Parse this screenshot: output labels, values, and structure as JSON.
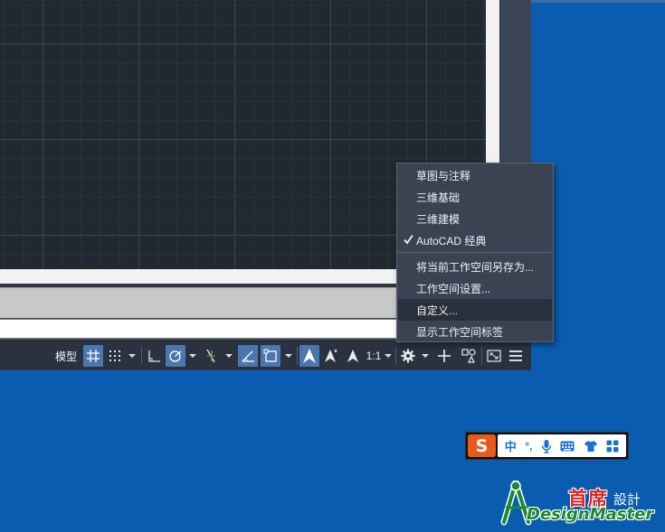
{
  "status_bar": {
    "model_label": "模型",
    "scale_label": "1:1"
  },
  "workspace_menu": {
    "items": [
      {
        "label": "草图与注释",
        "checked": false
      },
      {
        "label": "三维基础",
        "checked": false
      },
      {
        "label": "三维建模",
        "checked": false
      },
      {
        "label": "AutoCAD 经典",
        "checked": true
      },
      {
        "label": "将当前工作空间另存为...",
        "checked": false
      },
      {
        "label": "工作空间设置...",
        "checked": false
      },
      {
        "label": "自定义...",
        "checked": false,
        "highlighted": true
      },
      {
        "label": "显示工作空间标签",
        "checked": false
      }
    ]
  },
  "ime_toolbar": {
    "logo": "S",
    "mode_label": "中",
    "punct_label": "°,"
  },
  "watermark": {
    "chinese": "首席",
    "chinese_small": "設計",
    "english": "DesignMaster"
  },
  "colors": {
    "desktop": "#0a5cb0",
    "canvas": "#212830",
    "active_toggle": "#4b77b0",
    "menu_bg": "#3b4353",
    "ime_accent": "#e85a1c",
    "ime_blue": "#1572d6"
  }
}
